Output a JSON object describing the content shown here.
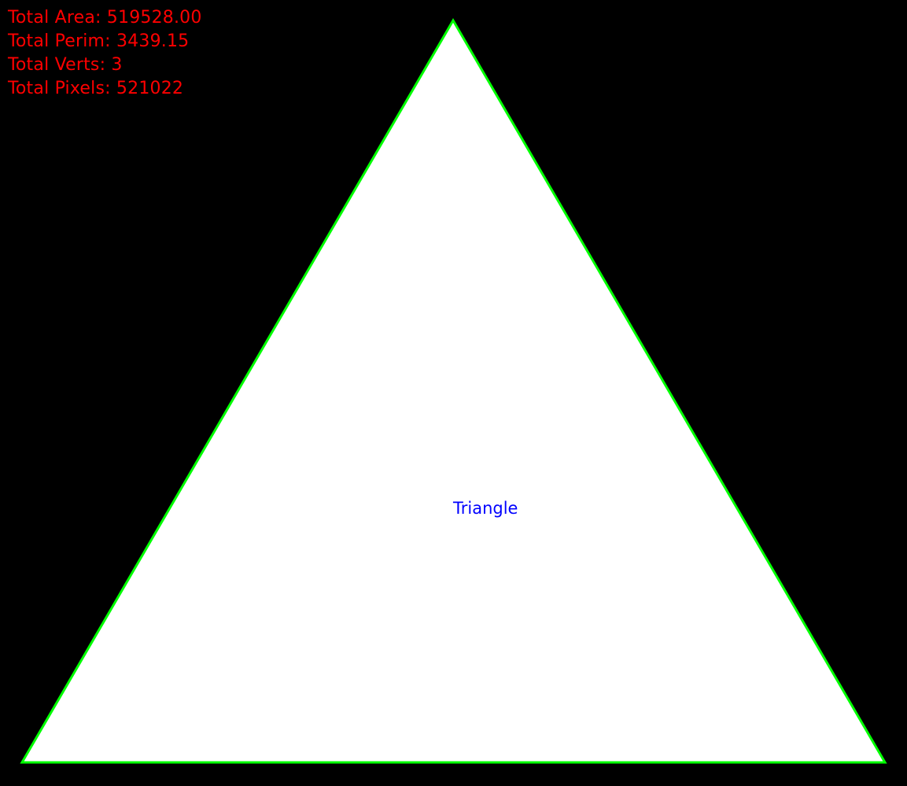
{
  "stats": {
    "area": "Total Area: 519528.00",
    "perimeter": "Total Perim: 3439.15",
    "vertices": "Total Verts: 3",
    "pixels": "Total Pixels: 521022"
  },
  "shape": {
    "label": "Triangle",
    "fill_color": "#ffffff",
    "outline_color": "#00ff00"
  },
  "colors": {
    "background": "#000000",
    "stats_text": "#ff0000",
    "label_text": "#0000ff"
  }
}
